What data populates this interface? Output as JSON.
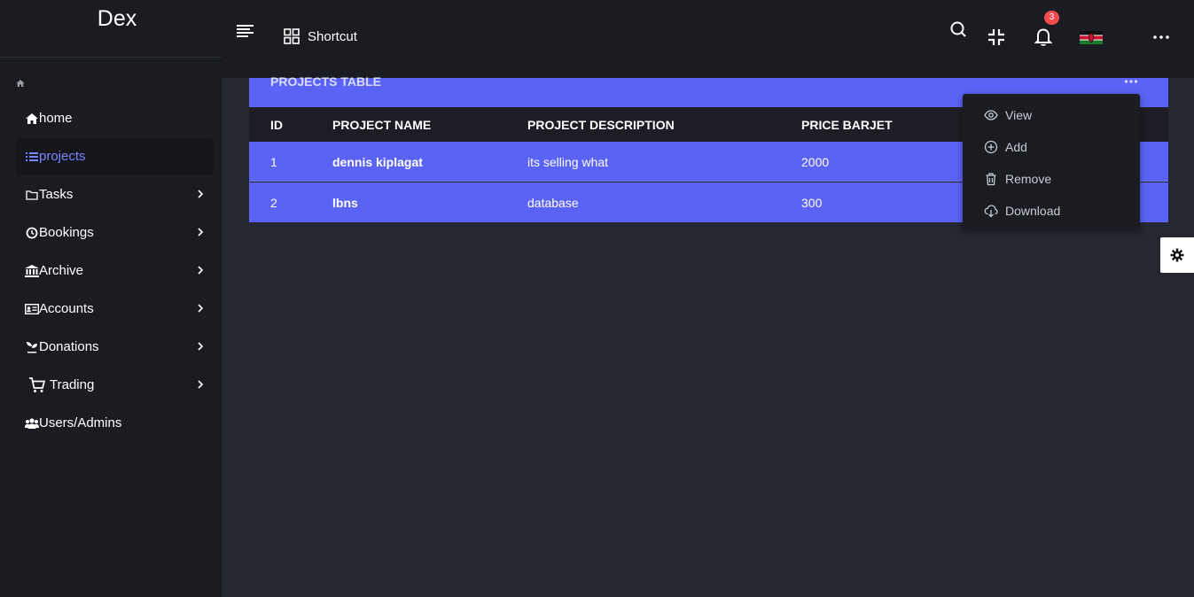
{
  "app": {
    "brand": "Dex"
  },
  "sidebar": {
    "items": [
      {
        "label": "home",
        "icon": "home-icon",
        "active": false,
        "submenu": false
      },
      {
        "label": "projects",
        "icon": "list-icon",
        "active": true,
        "submenu": false
      },
      {
        "label": "Tasks",
        "icon": "folder-icon",
        "active": false,
        "submenu": true
      },
      {
        "label": "Bookings",
        "icon": "clock-icon",
        "active": false,
        "submenu": true
      },
      {
        "label": "Archive",
        "icon": "bank-icon",
        "active": false,
        "submenu": true
      },
      {
        "label": "Accounts",
        "icon": "id-card-icon",
        "active": false,
        "submenu": true
      },
      {
        "label": "Donations",
        "icon": "seedling-icon",
        "active": false,
        "submenu": true
      },
      {
        "label": "Trading",
        "icon": "cart-icon",
        "active": false,
        "submenu": true
      },
      {
        "label": "Users/Admins",
        "icon": "users-icon",
        "active": false,
        "submenu": false
      }
    ]
  },
  "topbar": {
    "shortcut_label": "Shortcut",
    "notification_count": "3"
  },
  "card": {
    "title": "PROJECTS TABLE",
    "columns": [
      "ID",
      "PROJECT NAME",
      "PROJECT DESCRIPTION",
      "PRICE BARJET"
    ],
    "rows": [
      {
        "id": "1",
        "name": "dennis kiplagat",
        "description": "its selling what",
        "price": "2000"
      },
      {
        "id": "2",
        "name": "lbns",
        "description": "database",
        "price": "300"
      }
    ]
  },
  "dropdown": {
    "items": [
      {
        "label": "View",
        "icon": "eye-icon"
      },
      {
        "label": "Add",
        "icon": "plus-circle-icon"
      },
      {
        "label": "Remove",
        "icon": "trash-icon"
      },
      {
        "label": "Download",
        "icon": "cloud-download-icon"
      }
    ]
  },
  "colors": {
    "accent": "#5a63f5",
    "active_nav": "#7b84ff",
    "sidebar_bg": "#1b1c22",
    "page_bg": "#252731",
    "badge": "#f04a4a"
  }
}
